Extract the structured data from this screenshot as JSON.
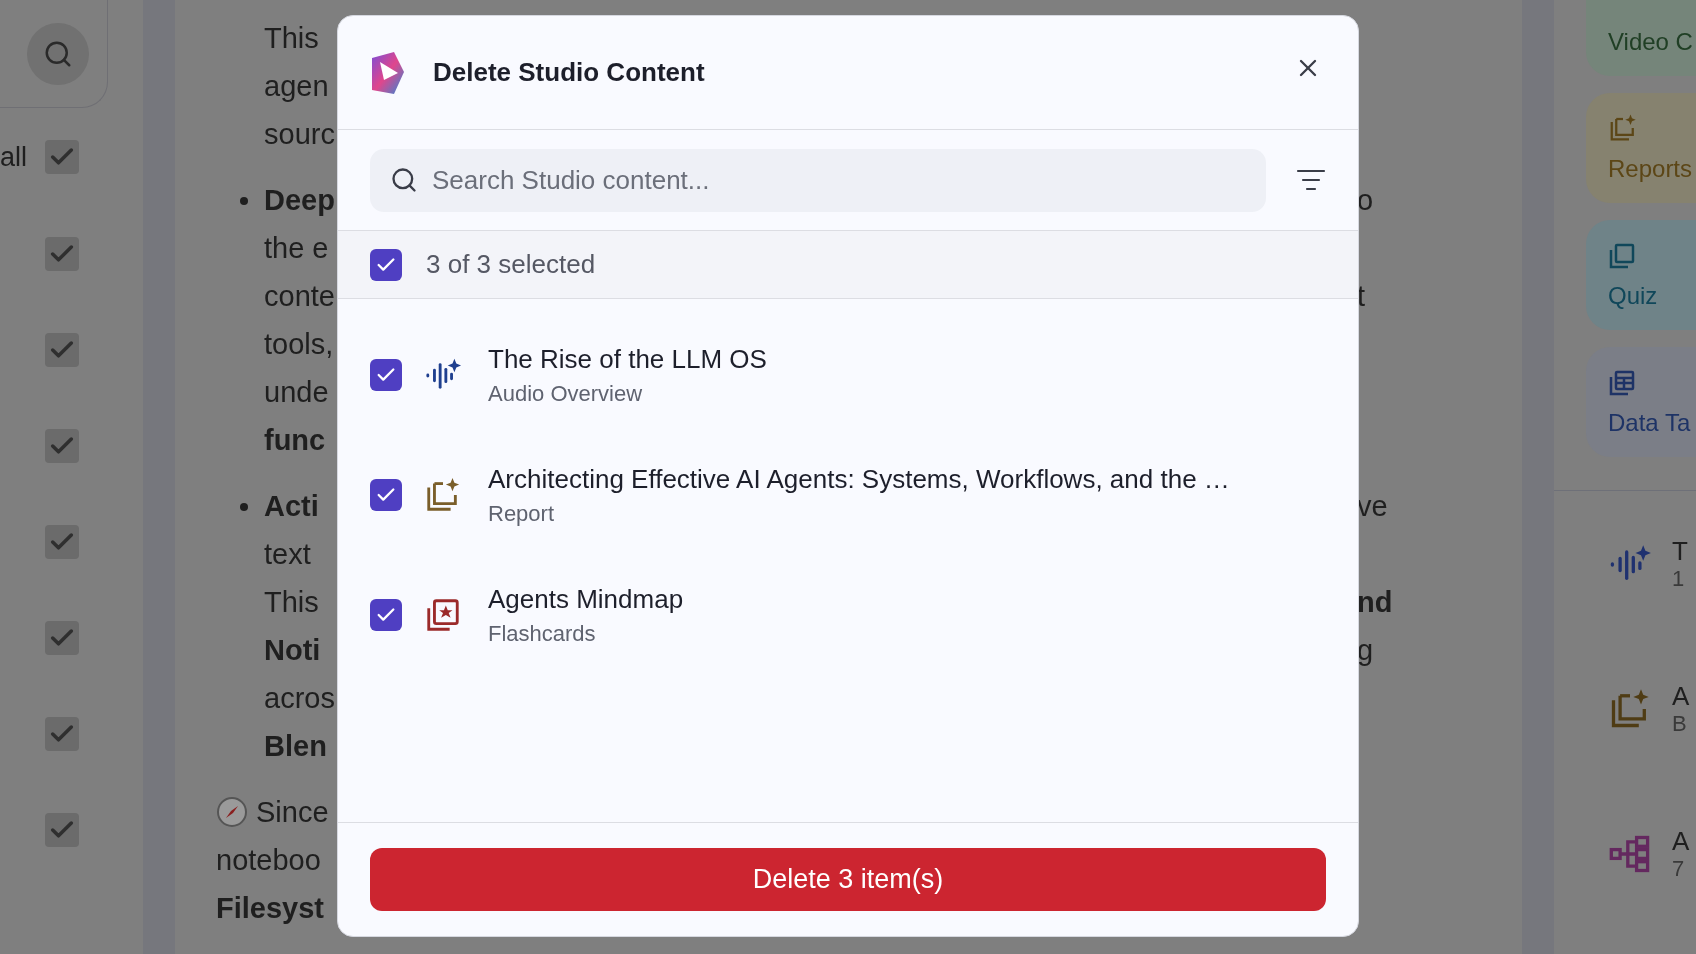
{
  "sources_panel": {
    "select_all_label": "all",
    "checkboxes": [
      {
        "checked": true
      },
      {
        "checked": true
      },
      {
        "checked": true
      },
      {
        "checked": true
      },
      {
        "checked": true
      },
      {
        "checked": true
      },
      {
        "checked": true
      },
      {
        "checked": true
      }
    ]
  },
  "chat": {
    "paragraphs": [
      {
        "kind": "text",
        "lines": [
          {
            "start": "This",
            "start_bold": false
          },
          {
            "start": "agen",
            "start_bold": false
          },
          {
            "start": "sourc",
            "start_bold": false
          }
        ]
      },
      {
        "kind": "bullet",
        "lines": [
          {
            "start": "Deep",
            "start_bold": true,
            "end": "o",
            "end_bold": false
          },
          {
            "start": "the e",
            "start_bold": false
          },
          {
            "start": "conte",
            "start_bold": false,
            "end": "t",
            "end_bold": false
          },
          {
            "start": "tools,",
            "start_bold": false
          },
          {
            "start": "unde",
            "start_bold": false
          },
          {
            "start": "func",
            "start_bold": true
          }
        ]
      },
      {
        "kind": "bullet",
        "lines": [
          {
            "start": "Acti",
            "start_bold": true,
            "end": "ve",
            "end_bold": false
          },
          {
            "start": "text",
            "start_bold": false
          },
          {
            "start": "This",
            "start_bold": false,
            "end": "nd",
            "end_bold": true
          },
          {
            "start": "Noti",
            "start_bold": true,
            "end": "g",
            "end_bold": false
          },
          {
            "start": "acros",
            "start_bold": false
          },
          {
            "start": "Blen",
            "start_bold": true
          }
        ]
      },
      {
        "kind": "note",
        "lines": [
          {
            "start": "Since",
            "start_bold": false
          },
          {
            "start": "noteboo",
            "start_bold": false
          },
          {
            "start": "Filesyst",
            "start_bold": true
          }
        ]
      }
    ]
  },
  "studio": {
    "cards": [
      {
        "kind": "video",
        "label": "Video C",
        "color": "#75857a"
      },
      {
        "kind": "report",
        "label": "Reports",
        "color": "#86826f"
      },
      {
        "kind": "quiz",
        "label": "Quiz",
        "color": "#6f8388"
      },
      {
        "kind": "table",
        "label": "Data Ta",
        "color": "#7b7e87"
      }
    ],
    "items": [
      {
        "kind": "audio",
        "title": "T",
        "subtitle": "1"
      },
      {
        "kind": "report",
        "title": "A",
        "subtitle": "B"
      },
      {
        "kind": "mindmap",
        "title": "A",
        "subtitle": "7"
      }
    ]
  },
  "dialog": {
    "title": "Delete Studio Content",
    "search": {
      "placeholder": "Search Studio content..."
    },
    "select_all": {
      "label": "3 of 3 selected",
      "checked": true
    },
    "items": [
      {
        "kind": "audio",
        "title": "The Rise of the LLM OS",
        "type": "Audio Overview",
        "checked": true
      },
      {
        "kind": "report",
        "title": "Architecting Effective AI Agents: Systems, Workflows, and the …",
        "type": "Report",
        "checked": true
      },
      {
        "kind": "flashcards",
        "title": "Agents Mindmap",
        "type": "Flashcards",
        "checked": true
      }
    ],
    "delete_button": "Delete 3 item(s)"
  }
}
